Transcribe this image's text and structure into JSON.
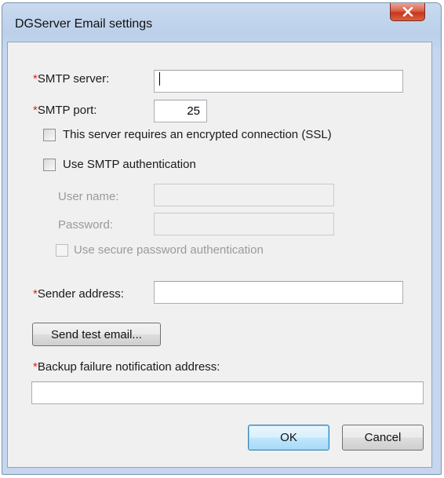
{
  "window": {
    "title": "DGServer Email settings",
    "close_glyph": "x"
  },
  "form": {
    "required_mark": "*",
    "smtp_server": {
      "label": "SMTP server:",
      "value": ""
    },
    "smtp_port": {
      "label": "SMTP port:",
      "value": "25"
    },
    "ssl": {
      "label": "This server requires an encrypted connection (SSL)",
      "checked": false
    },
    "smtp_auth": {
      "label": "Use SMTP authentication",
      "checked": false
    },
    "user_name": {
      "label": "User name:",
      "value": ""
    },
    "password": {
      "label": "Password:",
      "value": ""
    },
    "secure_password_auth": {
      "label": "Use secure password authentication",
      "checked": false
    },
    "sender_address": {
      "label": "Sender address:",
      "value": ""
    },
    "send_test_label": "Send test email...",
    "backup_failure": {
      "label": "Backup failure notification address:",
      "value": ""
    }
  },
  "buttons": {
    "ok_label": "OK",
    "cancel_label": "Cancel"
  },
  "colors": {
    "required": "#e0201b",
    "close_button": "#c7361f"
  }
}
